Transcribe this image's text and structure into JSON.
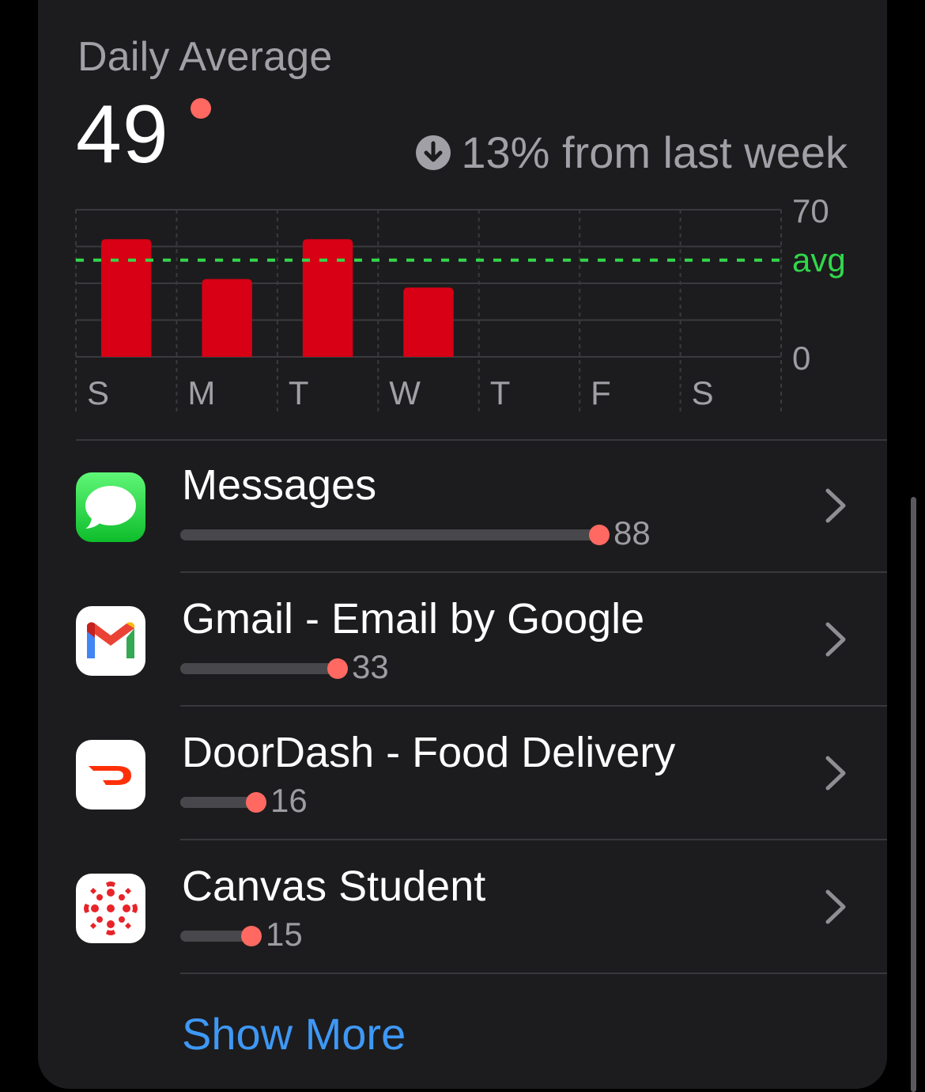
{
  "header": {
    "title": "Daily Average",
    "value": "49",
    "change_text": "13% from last week",
    "change_direction": "down"
  },
  "chart_data": {
    "type": "bar",
    "categories": [
      "S",
      "M",
      "T",
      "W",
      "T",
      "F",
      "S"
    ],
    "values": [
      56,
      37,
      56,
      33,
      null,
      null,
      null
    ],
    "ylim": [
      0,
      70
    ],
    "ytick_labels": [
      "70",
      "0"
    ],
    "average": 46,
    "average_label": "avg",
    "bar_color": "#d70015",
    "avg_color": "#32d74b",
    "grid": true
  },
  "apps": [
    {
      "name": "Messages",
      "count": "88",
      "value": 88,
      "icon": "messages-icon"
    },
    {
      "name": "Gmail - Email by Google",
      "count": "33",
      "value": 33,
      "icon": "gmail-icon"
    },
    {
      "name": "DoorDash - Food Delivery",
      "count": "16",
      "value": 16,
      "icon": "doordash-icon"
    },
    {
      "name": "Canvas Student",
      "count": "15",
      "value": 15,
      "icon": "canvas-icon"
    }
  ],
  "show_more_label": "Show More",
  "colors": {
    "accent_blue": "#3e98f5",
    "notification_red": "#ff6961",
    "card_background": "#1c1c1e"
  }
}
